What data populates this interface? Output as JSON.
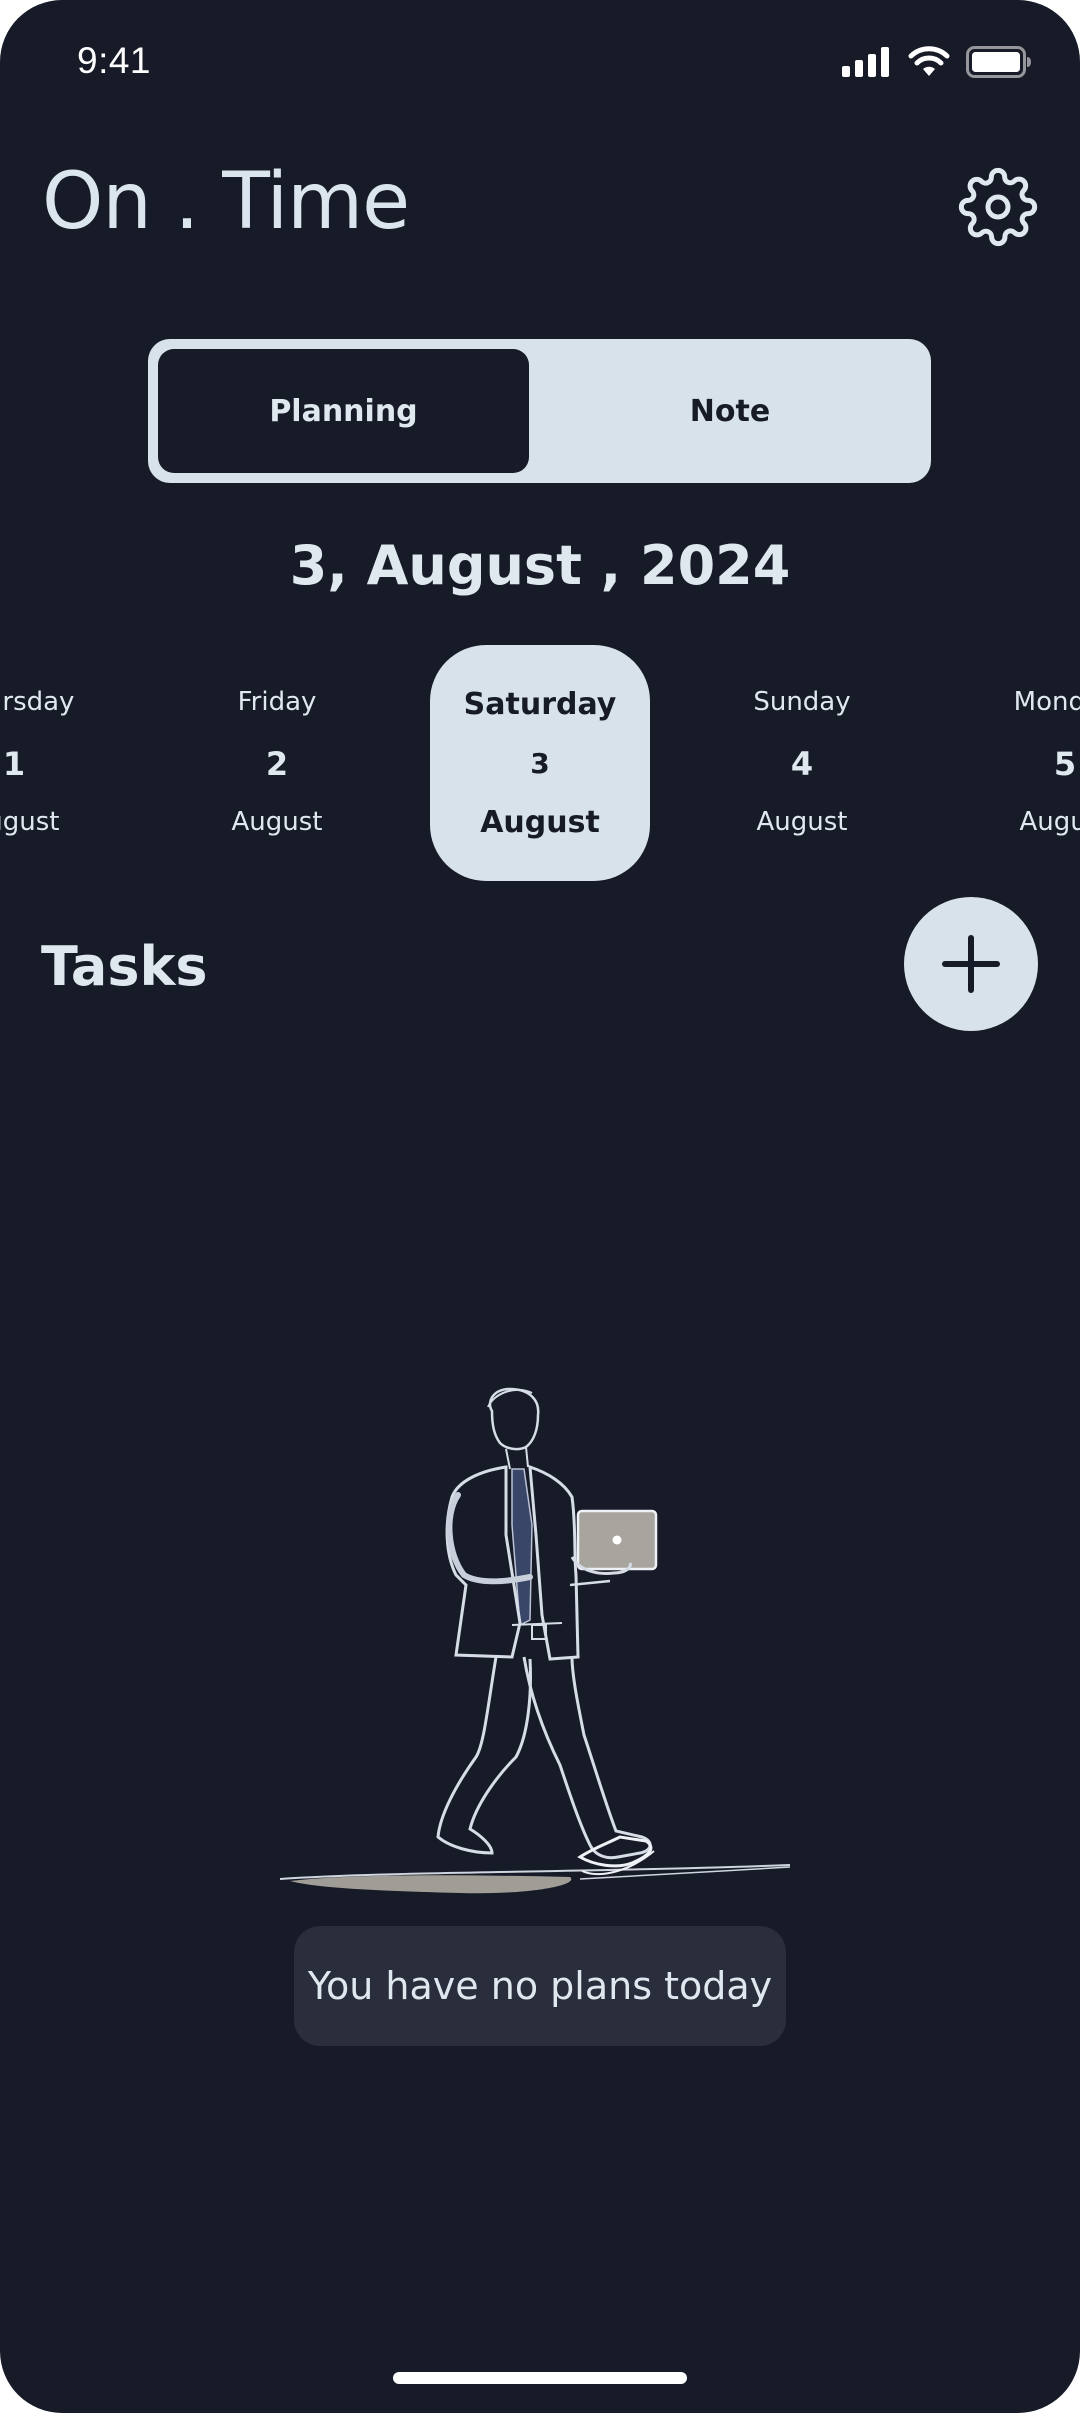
{
  "status_bar": {
    "time": "9:41",
    "icons": [
      "cellular-signal-icon",
      "wifi-icon",
      "battery-icon"
    ]
  },
  "header": {
    "title": "On . Time",
    "settings_icon": "gear-icon"
  },
  "segmented_control": {
    "options": [
      {
        "label": "Planning",
        "selected": true
      },
      {
        "label": "Note",
        "selected": false
      }
    ]
  },
  "current_date": "3, August , 2024",
  "days": [
    {
      "name": "Thursday",
      "number": "1",
      "month": "August",
      "selected": false
    },
    {
      "name": "Friday",
      "number": "2",
      "month": "August",
      "selected": false
    },
    {
      "name": "Saturday",
      "number": "3",
      "month": "August",
      "selected": true
    },
    {
      "name": "Sunday",
      "number": "4",
      "month": "August",
      "selected": false
    },
    {
      "name": "Monday",
      "number": "5",
      "month": "August",
      "selected": false
    }
  ],
  "tasks": {
    "title": "Tasks",
    "add_icon": "plus-icon",
    "empty_message": "You have no plans today"
  },
  "colors": {
    "background": "#171a27",
    "accent_light": "#d8e2ea",
    "text_light": "#dfe8ef",
    "message_bg": "#2a2d3b"
  }
}
